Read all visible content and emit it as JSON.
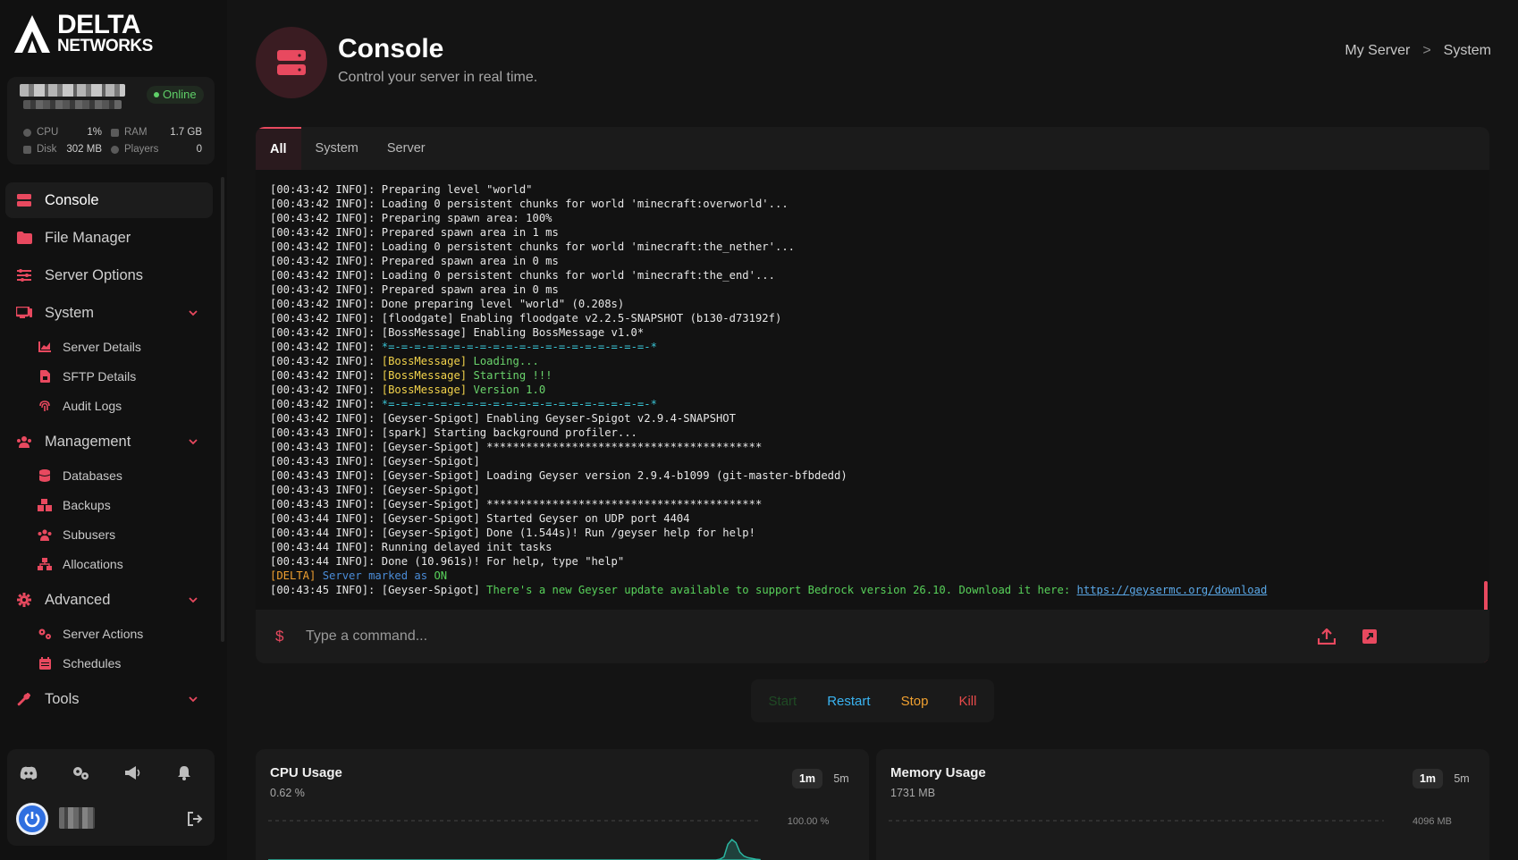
{
  "brand": {
    "line1": "DELTA",
    "line2": "NETWORKS"
  },
  "server_card": {
    "status": "Online",
    "stats": {
      "cpu_label": "CPU",
      "cpu_value": "1%",
      "ram_label": "RAM",
      "ram_value": "1.7 GB",
      "disk_label": "Disk",
      "disk_value": "302 MB",
      "players_label": "Players",
      "players_value": "0"
    }
  },
  "nav": {
    "console": "Console",
    "file_manager": "File Manager",
    "server_options": "Server Options",
    "system": "System",
    "server_details": "Server Details",
    "sftp_details": "SFTP Details",
    "audit_logs": "Audit Logs",
    "management": "Management",
    "databases": "Databases",
    "backups": "Backups",
    "subusers": "Subusers",
    "allocations": "Allocations",
    "advanced": "Advanced",
    "server_actions": "Server Actions",
    "schedules": "Schedules",
    "tools": "Tools"
  },
  "header": {
    "title": "Console",
    "subtitle": "Control your server in real time.",
    "breadcrumb": [
      "My Server",
      ">",
      "System"
    ]
  },
  "tabs": [
    "All",
    "System",
    "Server"
  ],
  "log_lines": [
    [
      [
        "t",
        "[00:43:42 INFO]: Preparing level \"world\""
      ]
    ],
    [
      [
        "t",
        "[00:43:42 INFO]: Loading 0 persistent chunks for world 'minecraft:overworld'..."
      ]
    ],
    [
      [
        "t",
        "[00:43:42 INFO]: Preparing spawn area: 100%"
      ]
    ],
    [
      [
        "t",
        "[00:43:42 INFO]: Prepared spawn area in 1 ms"
      ]
    ],
    [
      [
        "t",
        "[00:43:42 INFO]: Loading 0 persistent chunks for world 'minecraft:the_nether'..."
      ]
    ],
    [
      [
        "t",
        "[00:43:42 INFO]: Prepared spawn area in 0 ms"
      ]
    ],
    [
      [
        "t",
        "[00:43:42 INFO]: Loading 0 persistent chunks for world 'minecraft:the_end'..."
      ]
    ],
    [
      [
        "t",
        "[00:43:42 INFO]: Prepared spawn area in 0 ms"
      ]
    ],
    [
      [
        "t",
        "[00:43:42 INFO]: Done preparing level \"world\" (0.208s)"
      ]
    ],
    [
      [
        "t",
        "[00:43:42 INFO]: [floodgate] Enabling floodgate v2.2.5-SNAPSHOT (b130-d73192f)"
      ]
    ],
    [
      [
        "t",
        "[00:43:42 INFO]: [BossMessage] Enabling BossMessage v1.0*"
      ]
    ],
    [
      [
        "t",
        "[00:43:42 INFO]: "
      ],
      [
        "c",
        "*=-=-=-=-=-=-=-=-=-=-=-=-=-=-=-=-=-=-=-=-*"
      ]
    ],
    [
      [
        "t",
        "[00:43:42 INFO]: "
      ],
      [
        "y",
        "[BossMessage]"
      ],
      [
        "g",
        " Loading..."
      ]
    ],
    [
      [
        "t",
        "[00:43:42 INFO]: "
      ],
      [
        "y",
        "[BossMessage]"
      ],
      [
        "g",
        " Starting !!!"
      ]
    ],
    [
      [
        "t",
        "[00:43:42 INFO]: "
      ],
      [
        "y",
        "[BossMessage]"
      ],
      [
        "g",
        " Version 1.0"
      ]
    ],
    [
      [
        "t",
        "[00:43:42 INFO]: "
      ],
      [
        "c",
        "*=-=-=-=-=-=-=-=-=-=-=-=-=-=-=-=-=-=-=-=-*"
      ]
    ],
    [
      [
        "t",
        "[00:43:42 INFO]: [Geyser-Spigot] Enabling Geyser-Spigot v2.9.4-SNAPSHOT"
      ]
    ],
    [
      [
        "t",
        "[00:43:43 INFO]: [spark] Starting background profiler..."
      ]
    ],
    [
      [
        "t",
        "[00:43:43 INFO]: [Geyser-Spigot] ******************************************"
      ]
    ],
    [
      [
        "t",
        "[00:43:43 INFO]: [Geyser-Spigot]"
      ]
    ],
    [
      [
        "t",
        "[00:43:43 INFO]: [Geyser-Spigot] Loading Geyser version 2.9.4-b1099 (git-master-bfbdedd)"
      ]
    ],
    [
      [
        "t",
        "[00:43:43 INFO]: [Geyser-Spigot]"
      ]
    ],
    [
      [
        "t",
        "[00:43:43 INFO]: [Geyser-Spigot] ******************************************"
      ]
    ],
    [
      [
        "t",
        "[00:43:44 INFO]: [Geyser-Spigot] Started Geyser on UDP port 4404"
      ]
    ],
    [
      [
        "t",
        "[00:43:44 INFO]: [Geyser-Spigot] Done (1.544s)! Run /geyser help for help!"
      ]
    ],
    [
      [
        "t",
        "[00:43:44 INFO]: Running delayed init tasks"
      ]
    ],
    [
      [
        "t",
        "[00:43:44 INFO]: Done (10.961s)! For help, type \"help\""
      ]
    ],
    [
      [
        "o",
        "[DELTA]"
      ],
      [
        "b",
        " Server marked as "
      ],
      [
        "lg",
        "ON"
      ]
    ],
    [
      [
        "t",
        "[00:43:45 INFO]: [Geyser-Spigot] "
      ],
      [
        "lg",
        "There's a new Geyser update available to support Bedrock version 26.10. Download it here: "
      ],
      [
        "link",
        "https://geysermc.org/download"
      ]
    ]
  ],
  "command": {
    "prompt": "$",
    "placeholder": "Type a command..."
  },
  "power": {
    "start": "Start",
    "restart": "Restart",
    "stop": "Stop",
    "kill": "Kill"
  },
  "colors": {
    "accent": "#e8495f",
    "online": "#5fd068",
    "restart": "#3ab4f2",
    "stop": "#f0a030",
    "kill": "#e84a4a",
    "start_disabled": "#1f4a24",
    "chart_line": "#2bb5a0"
  },
  "cpu_chart": {
    "title": "CPU Usage",
    "value": "0.62 %",
    "ranges": [
      "1m",
      "5m"
    ],
    "max_label": "100.00 %",
    "chart_data": {
      "type": "area",
      "ymax": 100,
      "values": [
        0,
        0,
        0,
        0,
        0,
        0,
        0,
        0,
        0,
        0,
        0,
        0,
        0,
        0,
        0,
        0,
        0,
        0,
        0,
        0,
        0,
        0,
        0,
        0,
        0,
        0,
        0,
        0,
        0,
        0,
        0,
        0,
        0,
        0,
        0,
        0,
        0,
        0,
        0,
        0,
        0,
        0,
        0,
        0,
        0,
        0,
        0,
        0,
        0,
        0,
        0,
        0,
        0,
        0,
        0,
        0,
        0,
        0,
        0,
        0,
        0,
        0,
        0,
        0,
        0,
        0,
        0,
        0,
        0,
        0,
        0,
        0,
        0,
        0,
        0,
        0,
        0,
        0,
        0,
        0,
        0,
        0,
        0,
        0,
        0,
        0,
        0,
        0,
        0,
        0,
        0,
        0,
        0,
        0,
        0,
        0,
        0,
        0,
        0,
        0,
        0,
        0,
        0,
        0,
        0,
        0,
        0,
        0,
        0,
        0,
        0,
        0,
        0,
        2,
        8,
        40,
        52,
        44,
        20,
        10,
        6,
        4,
        2,
        1
      ]
    }
  },
  "memory_chart": {
    "title": "Memory Usage",
    "value": "1731 MB",
    "ranges": [
      "1m",
      "5m"
    ],
    "max_label": "4096 MB",
    "chart_data": {
      "type": "area",
      "ymax": 4096,
      "values": []
    }
  },
  "icons": {
    "console": "server-icon",
    "file_manager": "folder-icon",
    "server_options": "sliders-icon",
    "system": "monitor-icon",
    "management": "users-icon",
    "advanced": "gear-icon",
    "tools": "wrench-icon"
  }
}
